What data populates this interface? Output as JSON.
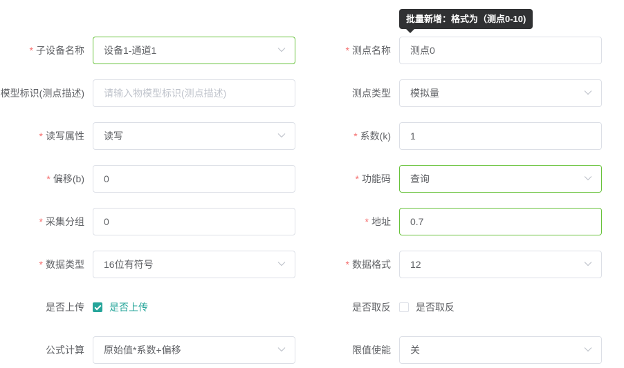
{
  "tooltip": "批量新增：格式为（测点0-10)",
  "rows": [
    {
      "left": {
        "label": "子设备名称",
        "required": "*",
        "value": "设备1-通道1",
        "kind": "select"
      },
      "right": {
        "label": "测点名称",
        "required": "*",
        "value": "测点0",
        "kind": "input"
      }
    },
    {
      "left": {
        "label": "模型标识(测点描述)",
        "required": "",
        "placeholder": "请输入物模型标识(测点描述)",
        "kind": "input"
      },
      "right": {
        "label": "测点类型",
        "required": "",
        "value": "模拟量",
        "kind": "select"
      }
    },
    {
      "left": {
        "label": "读写属性",
        "required": "*",
        "value": "读写",
        "kind": "select"
      },
      "right": {
        "label": "系数(k)",
        "required": "*",
        "value": "1",
        "kind": "input"
      }
    },
    {
      "left": {
        "label": "偏移(b)",
        "required": "*",
        "value": "0",
        "kind": "input"
      },
      "right": {
        "label": "功能码",
        "required": "*",
        "value": "查询",
        "kind": "select"
      }
    },
    {
      "left": {
        "label": "采集分组",
        "required": "*",
        "value": "0",
        "kind": "input"
      },
      "right": {
        "label": "地址",
        "required": "*",
        "value": "0.7",
        "kind": "input"
      }
    },
    {
      "left": {
        "label": "数据类型",
        "required": "*",
        "value": "16位有符号",
        "kind": "select"
      },
      "right": {
        "label": "数据格式",
        "required": "*",
        "value": "12",
        "kind": "select"
      }
    },
    {
      "left": {
        "label": "是否上传",
        "required": "",
        "check_label": "是否上传",
        "checked": true,
        "kind": "checkbox"
      },
      "right": {
        "label": "是否取反",
        "required": "",
        "check_label": "是否取反",
        "checked": false,
        "kind": "checkbox"
      }
    },
    {
      "left": {
        "label": "公式计算",
        "required": "",
        "value": "原始值*系数+偏移",
        "kind": "select"
      },
      "right": {
        "label": "限值使能",
        "required": "",
        "value": "关",
        "kind": "select"
      }
    }
  ],
  "colors": {
    "required": "#f56c6c",
    "focus_border": "#67c23a",
    "checkbox_active": "#26a59a",
    "tooltip_bg": "#303133"
  }
}
